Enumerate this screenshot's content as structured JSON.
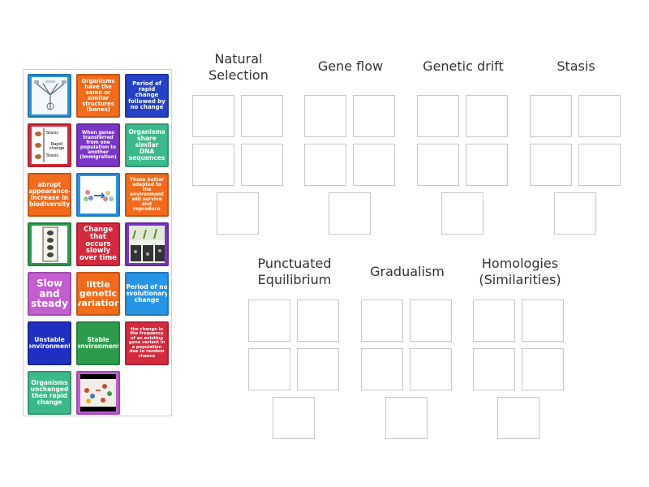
{
  "tray": {
    "tiles": {
      "t1": {
        "icon": "evolution-tree-diagram-icon"
      },
      "t2": {
        "text": "Organisms have the same or similar structures (bones)"
      },
      "t3": {
        "text": "Period of rapid change followed by no change"
      },
      "t4": {
        "icon": "punctuated-equilibrium-diagram-icon",
        "labels": [
          "Stasis",
          "Rapid change",
          "Stasis"
        ]
      },
      "t5": {
        "text": "When genes transferred from one population to another (Immigration)"
      },
      "t6": {
        "text": "Organisms share similar DNA sequences"
      },
      "t7": {
        "text": "abrupt appearance- increase in biodiversity"
      },
      "t8": {
        "icon": "gene-flow-population-icon"
      },
      "t9": {
        "text": "Those better adapted to the environment will survive and reproduce"
      },
      "t10": {
        "icon": "fossil-layers-icon"
      },
      "t11": {
        "text": "Change that occurs slowly over time"
      },
      "t12": {
        "icon": "gradual-change-illustration-icon"
      },
      "t13": {
        "text": "Slow and steady"
      },
      "t14": {
        "text": "little genetic variation"
      },
      "t15": {
        "text": "Period of no evolutionary change"
      },
      "t16": {
        "text": "Unstable environment"
      },
      "t17": {
        "text": "Stable environment"
      },
      "t18": {
        "text": "the change in the frequency of an existing gene variant in a population due to random chance"
      },
      "t19": {
        "text": "Organisms unchanged then rapid change"
      },
      "t20": {
        "icon": "population-photo-icon"
      }
    }
  },
  "groups": {
    "g1": {
      "title": "Natural Selection"
    },
    "g2": {
      "title": "Gene flow"
    },
    "g3": {
      "title": "Genetic drift"
    },
    "g4": {
      "title": "Stasis"
    },
    "g5": {
      "title": "Punctuated Equilibrium"
    },
    "g6": {
      "title": "Gradualism"
    },
    "g7": {
      "title": "Homologies (Similarities)"
    }
  },
  "colors": {
    "orange": "#f26a1b",
    "blue": "#2541c8",
    "purple": "#7b35c9",
    "teal": "#3cb98a",
    "red": "#d52a3e",
    "green": "#2c9c4c",
    "violet": "#c35ed1",
    "lightblue": "#2894e6",
    "navy": "#1f2fc0"
  }
}
